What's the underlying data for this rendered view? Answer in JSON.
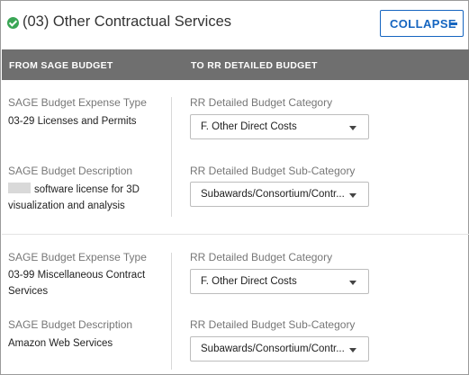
{
  "header": {
    "title": "(03) Other Contractual Services",
    "collapse_label": "COLLAPSE"
  },
  "columns": {
    "left": "FROM SAGE BUDGET",
    "right": "TO RR DETAILED BUDGET"
  },
  "items": [
    {
      "expense_type_label": "SAGE Budget Expense Type",
      "expense_type_value": "03-29 Licenses and Permits",
      "description_label": "SAGE Budget Description",
      "description_value": "software license for 3D visualization and analysis",
      "category_label": "RR Detailed Budget Category",
      "category_value": "F. Other Direct Costs",
      "subcategory_label": "RR Detailed Budget Sub-Category",
      "subcategory_value": "Subawards/Consortium/Contr..."
    },
    {
      "expense_type_label": "SAGE Budget Expense Type",
      "expense_type_value": "03-99 Miscellaneous Contract Services",
      "description_label": "SAGE Budget Description",
      "description_value": "Amazon Web Services",
      "category_label": "RR Detailed Budget Category",
      "category_value": "F. Other Direct Costs",
      "subcategory_label": "RR Detailed Budget Sub-Category",
      "subcategory_value": "Subawards/Consortium/Contr..."
    }
  ],
  "colors": {
    "accent": "#1565c0",
    "success": "#3aa655",
    "header_bar": "#6f6f6f"
  },
  "icons": {
    "status": "check-circle-icon",
    "collapse": "minus-icon",
    "dropdown": "chevron-down-icon"
  }
}
